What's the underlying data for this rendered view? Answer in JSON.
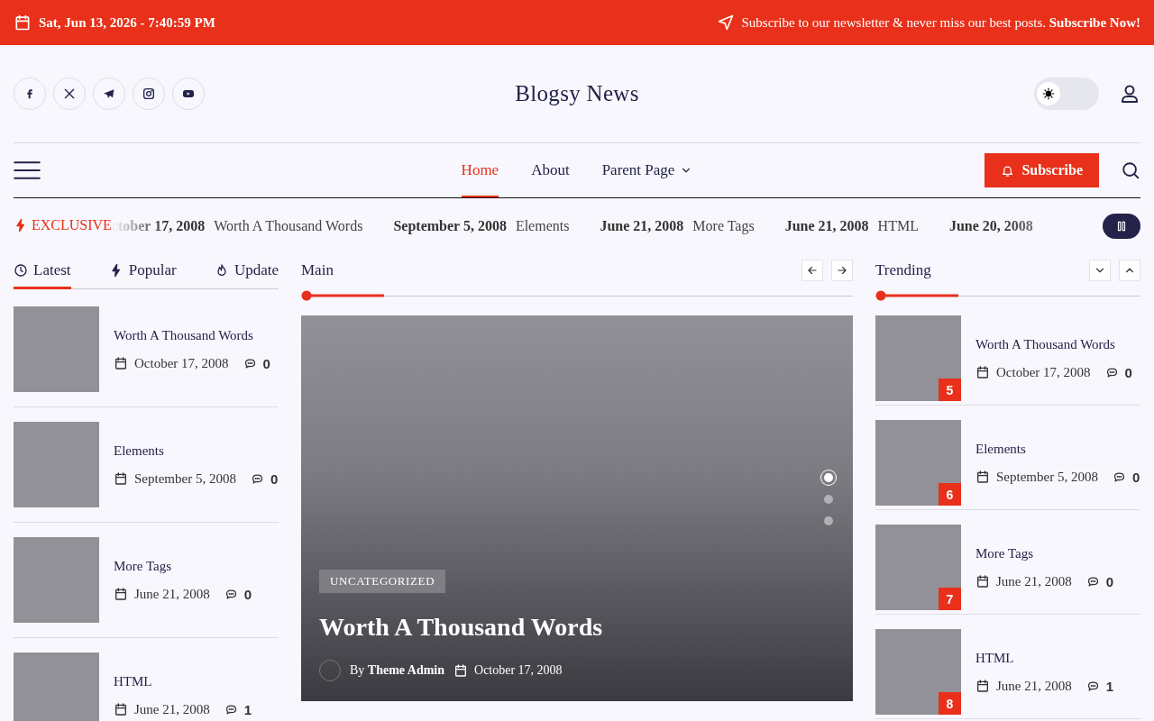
{
  "top_bar": {
    "datetime": "Sat, Jun 13, 2026 - 7:40:59 PM",
    "newsletter_text": "Subscribe to our newsletter & never miss our best posts.",
    "newsletter_link": "Subscribe Now!"
  },
  "header": {
    "socials": [
      {
        "kind": "facebook"
      },
      {
        "kind": "x"
      },
      {
        "kind": "telegram"
      },
      {
        "kind": "instagram"
      },
      {
        "kind": "youtube"
      }
    ],
    "site_title": "Blogsy News",
    "dark_mode": false
  },
  "nav": {
    "items": [
      {
        "label": "Home",
        "selected": true,
        "has_dropdown": false
      },
      {
        "label": "About",
        "selected": false,
        "has_dropdown": false
      },
      {
        "label": "Parent Page",
        "selected": false,
        "has_dropdown": true
      }
    ],
    "subscribe_button": "Subscribe"
  },
  "ticker": {
    "label": "EXCLUSIVE",
    "items": [
      {
        "date": "ctober 17, 2008",
        "title": "Worth A Thousand Words"
      },
      {
        "date": "September 5, 2008",
        "title": "Elements"
      },
      {
        "date": "June 21, 2008",
        "title": "More Tags"
      },
      {
        "date": "June 21, 2008",
        "title": "HTML"
      },
      {
        "date": "June 20, 2008"
      }
    ],
    "paused": false
  },
  "left_tabs": [
    {
      "label": "Latest",
      "kind": "clock",
      "selected": true
    },
    {
      "label": "Popular",
      "kind": "bolt",
      "selected": false
    },
    {
      "label": "Update",
      "kind": "flame",
      "selected": false
    }
  ],
  "latest_posts": [
    {
      "title": "Worth A Thousand Words",
      "date": "October 17, 2008",
      "comments": "0"
    },
    {
      "title": "Elements",
      "date": "September 5, 2008",
      "comments": "0"
    },
    {
      "title": "More Tags",
      "date": "June 21, 2008",
      "comments": "0"
    },
    {
      "title": "HTML",
      "date": "June 21, 2008",
      "comments": "1"
    }
  ],
  "main": {
    "heading": "Main",
    "slides": [
      {
        "selected": true
      },
      {
        "selected": false
      },
      {
        "selected": false
      }
    ],
    "category": "UNCATEGORIZED",
    "title": "Worth A Thousand Words",
    "by": "By",
    "author": "Theme Admin",
    "date": "October 17, 2008"
  },
  "trending": {
    "heading": "Trending",
    "posts": [
      {
        "rank": "5",
        "title": "Worth A Thousand Words",
        "date": "October 17, 2008",
        "comments": "0"
      },
      {
        "rank": "6",
        "title": "Elements",
        "date": "September 5, 2008",
        "comments": "0"
      },
      {
        "rank": "7",
        "title": "More Tags",
        "date": "June 21, 2008",
        "comments": "0"
      },
      {
        "rank": "8",
        "title": "HTML",
        "date": "June 21, 2008",
        "comments": "1"
      }
    ]
  }
}
